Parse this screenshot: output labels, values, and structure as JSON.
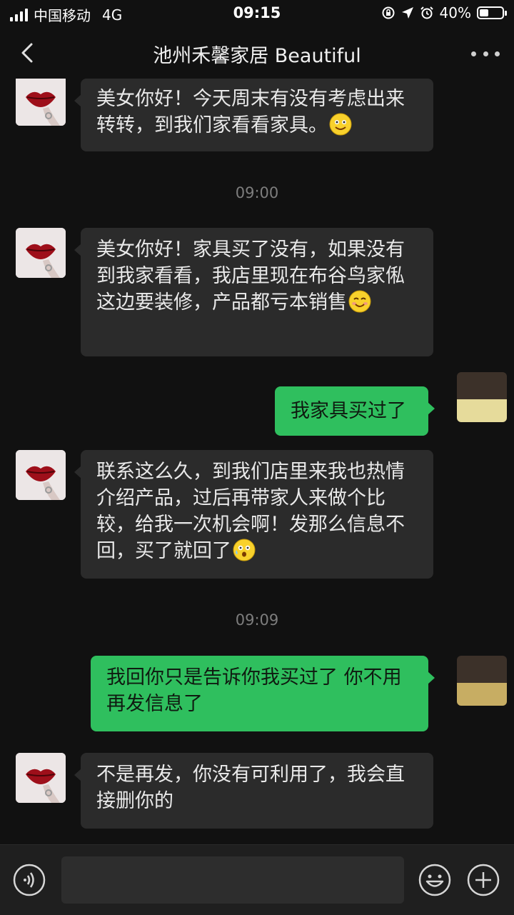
{
  "status_bar": {
    "carrier": "中国移动",
    "network": "4G",
    "time": "09:15",
    "battery": "40%",
    "battery_level": 0.4
  },
  "header": {
    "title": "池州禾馨家居 Beautiful"
  },
  "messages": [
    {
      "text": "美女你好！今天周末有没有考虑出来转转，到我们家看看家具。",
      "emoji": "smile-emoji"
    },
    {
      "timestamp": "09:00"
    },
    {
      "text": "美女你好！家具买了没有，如果没有到我家看看，我店里现在布谷鸟家俬这边要装修，产品都亏本销售",
      "emoji": "blush-emoji"
    },
    {
      "text": "我家具买过了"
    },
    {
      "text": "联系这么久，到我们店里来我也热情介绍产品，过后再带家人来做个比较，给我一次机会啊！发那么信息不回，买了就回了",
      "emoji": "sweat-emoji"
    },
    {
      "timestamp": "09:09"
    },
    {
      "text": "我回你只是告诉你我买过了  你不用再发信息了"
    },
    {
      "text": "不是再发，你没有可利用了，我会直接删你的"
    }
  ],
  "colors": {
    "background": "#111111",
    "incoming_bubble": "#2b2b2b",
    "outgoing_bubble": "#2fbf5e"
  }
}
